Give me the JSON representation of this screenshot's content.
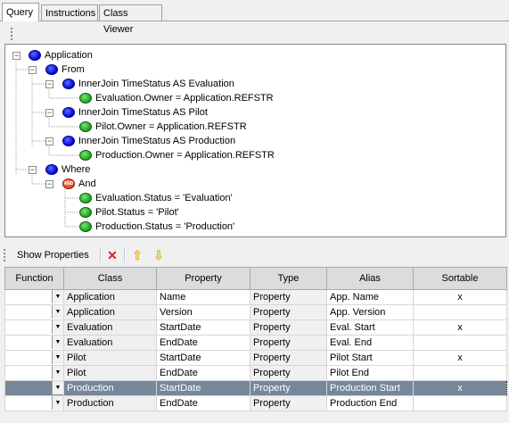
{
  "tabs": [
    {
      "label": "Query"
    },
    {
      "label": "Instructions"
    },
    {
      "label": "Class Viewer"
    }
  ],
  "tree": {
    "root": "Application",
    "from": "From",
    "join1": "InnerJoin  TimeStatus AS Evaluation",
    "cond1": "Evaluation.Owner = Application.REFSTR",
    "join2": "InnerJoin  TimeStatus AS Pilot",
    "cond2": "Pilot.Owner = Application.REFSTR",
    "join3": "InnerJoin  TimeStatus AS Production",
    "cond3": "Production.Owner = Application.REFSTR",
    "where": "Where",
    "and": "And",
    "and_icon_text": "AND",
    "w1": "Evaluation.Status = 'Evaluation'",
    "w2": "Pilot.Status = 'Pilot'",
    "w3": "Production.Status = 'Production'"
  },
  "toolbar": {
    "show_properties": "Show Properties",
    "delete_icon": "red-x-icon",
    "up_icon": "arrow-up-icon",
    "down_icon": "arrow-down-icon"
  },
  "grid": {
    "headers": [
      "Function",
      "Class",
      "Property",
      "Type",
      "Alias",
      "Sortable"
    ],
    "rows": [
      {
        "class": "Application",
        "property": "Name",
        "type": "Property",
        "alias": "App. Name",
        "sortable": "x"
      },
      {
        "class": "Application",
        "property": "Version",
        "type": "Property",
        "alias": "App. Version",
        "sortable": ""
      },
      {
        "class": "Evaluation",
        "property": "StartDate",
        "type": "Property",
        "alias": "Eval. Start",
        "sortable": "x"
      },
      {
        "class": "Evaluation",
        "property": "EndDate",
        "type": "Property",
        "alias": "Eval. End",
        "sortable": ""
      },
      {
        "class": "Pilot",
        "property": "StartDate",
        "type": "Property",
        "alias": "Pilot Start",
        "sortable": "x"
      },
      {
        "class": "Pilot",
        "property": "EndDate",
        "type": "Property",
        "alias": "Pilot End",
        "sortable": ""
      },
      {
        "class": "Production",
        "property": "StartDate",
        "type": "Property",
        "alias": "Production Start",
        "sortable": "x"
      },
      {
        "class": "Production",
        "property": "EndDate",
        "type": "Property",
        "alias": "Production End",
        "sortable": ""
      }
    ]
  },
  "colors": {
    "selected_row": "#76879a",
    "blue_node": "#0000d8",
    "green_node": "#19a019",
    "and_node": "#e0401a"
  }
}
